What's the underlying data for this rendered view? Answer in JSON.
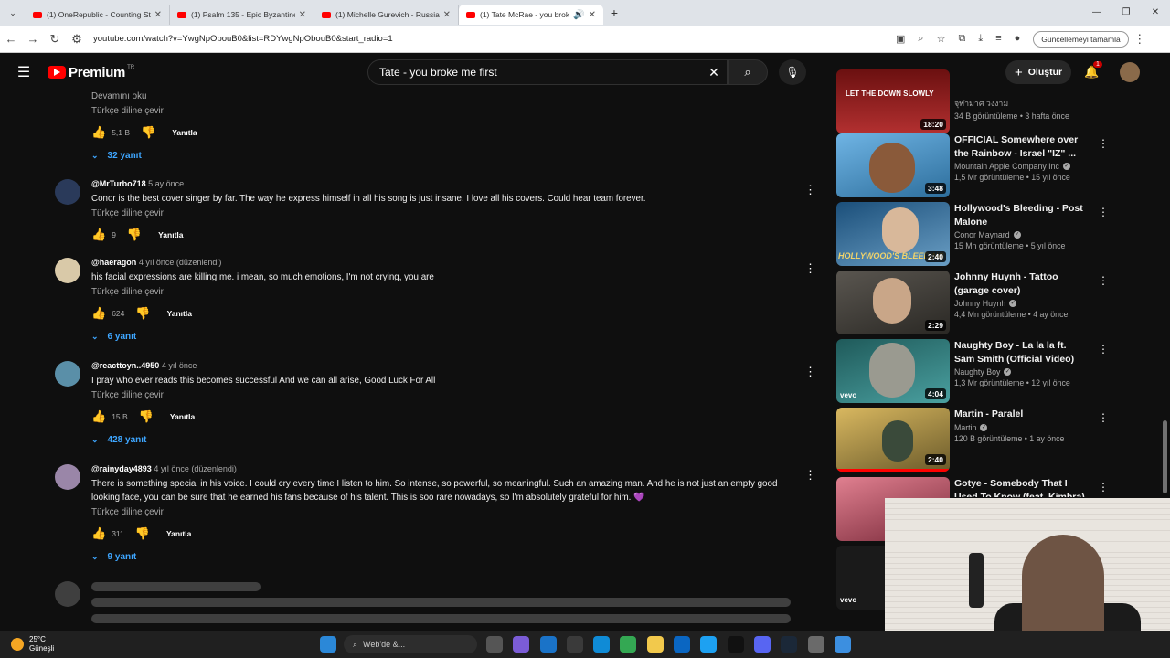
{
  "browser": {
    "tabs": [
      {
        "title": "(1) OneRepublic - Counting Sta",
        "active": false
      },
      {
        "title": "(1) Psalm 135 - Epic Byzantine",
        "active": false
      },
      {
        "title": "(1) Michelle Gurevich - Russian",
        "active": false
      },
      {
        "title": "(1) Tate McRae - you broke",
        "active": true
      }
    ],
    "url": "youtube.com/watch?v=YwgNpObouB0&list=RDYwgNpObouB0&start_radio=1",
    "update_label": "Güncellemeyi tamamla"
  },
  "header": {
    "logo_text": "Premium",
    "country": "TR",
    "search_value": "Tate - you broke me first",
    "create_label": "Oluştur",
    "notif_count": "1"
  },
  "comments": [
    {
      "read_more": "Devamını oku",
      "translate": "Türkçe diline çevir",
      "likes": "5,1 B",
      "reply": "Yanıtla",
      "replies": "32 yanıt"
    },
    {
      "user": "@MrTurbo718",
      "time": "5 ay önce",
      "text": "Conor is the best cover singer by far. The way he express himself in all his song is just insane. I love all his covers. Could hear team forever.",
      "translate": "Türkçe diline çevir",
      "likes": "9",
      "reply": "Yanıtla",
      "replies": ""
    },
    {
      "user": "@haeragon",
      "time": "4 yıl önce (düzenlendi)",
      "text": "his facial expressions are killing me. i mean, so much emotions, I'm not crying, you are",
      "translate": "Türkçe diline çevir",
      "likes": "624",
      "reply": "Yanıtla",
      "replies": "6 yanıt"
    },
    {
      "user": "@reacttoyn..4950",
      "time": "4 yıl önce",
      "text": "I pray who ever reads this becomes successful And we can all arise, Good Luck For All",
      "translate": "Türkçe diline çevir",
      "likes": "15 B",
      "reply": "Yanıtla",
      "replies": "428 yanıt"
    },
    {
      "user": "@rainyday4893",
      "time": "4 yıl önce (düzenlendi)",
      "text": "There is something special in his voice. I could cry every time I listen to him. So intense, so powerful, so meaningful. Such an amazing man. And he is not just an empty good looking face, you can be sure that he earned his fans because of his talent. This is soo rare nowadays, so I'm absolutely grateful for him. 💜",
      "translate": "Türkçe diline çevir",
      "likes": "311",
      "reply": "Yanıtla",
      "replies": "9 yanıt"
    }
  ],
  "sidebar": [
    {
      "title": "",
      "thumb_text": "LET THE DOWN SLOWLY",
      "channel": "จุฬามาศ วงงาม",
      "verified": false,
      "meta": "34 B görüntüleme • 3 hafta önce",
      "duration": "18:20",
      "thumb_color": "#8b1c1c"
    },
    {
      "title": "OFFICIAL Somewhere over the Rainbow - Israel \"IZ\" ...",
      "channel": "Mountain Apple Company Inc",
      "verified": true,
      "meta": "1,5 Mr görüntüleme • 15 yıl önce",
      "duration": "3:48",
      "thumb_color": "#4f9bd1"
    },
    {
      "title": "Hollywood's Bleeding - Post Malone",
      "channel": "Conor Maynard",
      "verified": true,
      "meta": "15 Mn görüntüleme • 5 yıl önce",
      "duration": "2:40",
      "thumb_color": "#2e6fa0",
      "thumb_text": "HOLLYWOOD'S BLEEDING"
    },
    {
      "title": "Johnny Huynh - Tattoo (garage cover)",
      "channel": "Johnny Huynh",
      "verified": true,
      "meta": "4,4 Mn görüntüleme • 4 ay önce",
      "duration": "2:29",
      "thumb_color": "#3d3a36"
    },
    {
      "title": "Naughty Boy - La la la ft. Sam Smith (Official Video)",
      "channel": "Naughty Boy",
      "verified": true,
      "meta": "1,3 Mr görüntüleme • 12 yıl önce",
      "duration": "4:04",
      "thumb_color": "#2a6e6e",
      "thumb_text": "vevo"
    },
    {
      "title": "Martin - Paralel",
      "channel": "Martin",
      "verified": true,
      "meta": "120 B görüntüleme • 1 ay önce",
      "duration": "2:40",
      "thumb_color": "#c9a44a"
    },
    {
      "title": "Gotye - Somebody That I Used To Know (feat. Kimbra) [Offici",
      "channel": "",
      "verified": false,
      "meta": "",
      "duration": "",
      "thumb_color": "#b34a5c"
    },
    {
      "title": "",
      "channel": "",
      "verified": false,
      "meta": "",
      "duration": "",
      "thumb_color": "#1a1a1a",
      "thumb_text": "vevo"
    }
  ],
  "taskbar": {
    "temp": "25°C",
    "weather": "Güneşli",
    "search_placeholder": "Web'de &..."
  },
  "colors": {
    "bg": "#0f0f0f",
    "link": "#3ea6ff",
    "yt_red": "#ff0000"
  }
}
